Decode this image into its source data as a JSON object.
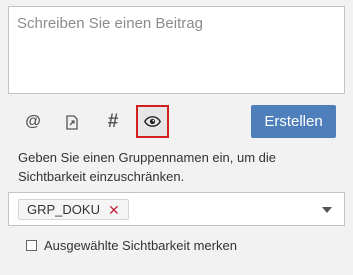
{
  "compose": {
    "placeholder": "Schreiben Sie einen Beitrag",
    "value": ""
  },
  "toolbar": {
    "mention_symbol": "@",
    "hashtag_symbol": "#",
    "link_icon": "document-link-icon",
    "visibility_icon": "eye-icon",
    "highlight_color": "#d0201f",
    "create_label": "Erstellen",
    "create_color": "#4f7fba"
  },
  "visibility": {
    "hint": "Geben Sie einen Gruppennamen ein, um die Sichtbarkeit einzuschränken.",
    "selected_groups": [
      "GRP_DOKU"
    ],
    "remove_symbol": "✕",
    "remember_label": "Ausgewählte Sichtbarkeit merken",
    "remember_checked": false
  }
}
